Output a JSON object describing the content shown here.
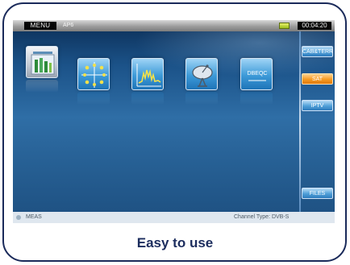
{
  "topbar": {
    "menu_label": "MENU",
    "subtitle": "AP6",
    "clock": "00:04:20"
  },
  "tiles": [
    {
      "name": "meter-tile",
      "icon": "bar-meter-icon"
    },
    {
      "name": "constellation-tile",
      "icon": "constellation-icon"
    },
    {
      "name": "spectrum-tile",
      "icon": "spectrum-icon"
    },
    {
      "name": "satellite-dish-tile",
      "icon": "satellite-dish-icon"
    },
    {
      "name": "dbeqc-tile",
      "icon": "text-icon",
      "label": "DBEQC"
    }
  ],
  "side_buttons": [
    {
      "label": "CAB&TERR",
      "active": false
    },
    {
      "label": "SAT",
      "active": true
    },
    {
      "label": "IPTV",
      "active": false
    },
    {
      "label": "FILES",
      "active": false
    }
  ],
  "status": {
    "left": "MEAS",
    "right": "Channel Type: DVB-S"
  },
  "caption": "Easy to use",
  "colors": {
    "frame": "#1a2a5a",
    "screen_bg": "#1b5288",
    "accent_active": "#f59b22",
    "accent_tile": "#3d9ad8"
  }
}
